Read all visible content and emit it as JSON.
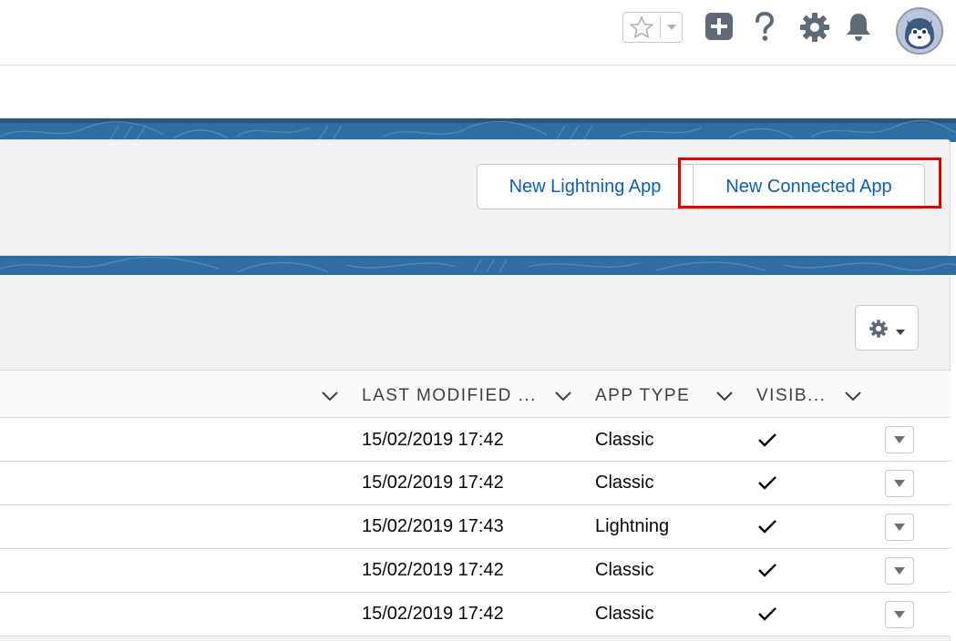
{
  "header": {
    "icons": [
      "star-icon",
      "chevron-down-icon",
      "add-icon",
      "help-icon",
      "gear-icon",
      "bell-icon",
      "avatar"
    ]
  },
  "actions": {
    "new_lightning_app": "New Lightning App",
    "new_connected_app": "New Connected App"
  },
  "table": {
    "columns": [
      "LAST MODIFIED ...",
      "APP TYPE",
      "VISIB..."
    ],
    "rows": [
      {
        "modified": "15/02/2019 17:42",
        "type": "Classic",
        "visible": true
      },
      {
        "modified": "15/02/2019 17:42",
        "type": "Classic",
        "visible": true
      },
      {
        "modified": "15/02/2019 17:43",
        "type": "Lightning",
        "visible": true
      },
      {
        "modified": "15/02/2019 17:42",
        "type": "Classic",
        "visible": true
      },
      {
        "modified": "15/02/2019 17:42",
        "type": "Classic",
        "visible": true
      }
    ]
  },
  "colors": {
    "brand_band": "#2f6ea3",
    "link_blue": "#0b5db6",
    "highlight_red": "#e00000",
    "icon_gray": "#5f6a77"
  }
}
